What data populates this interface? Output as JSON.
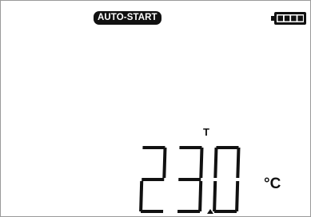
{
  "status_bar": {
    "mode_badge": "AUTO-START",
    "battery": {
      "icon": "battery-full-icon",
      "level": 1.0
    }
  },
  "measurement": {
    "label": "T",
    "value": "23.0",
    "unit": "°C"
  },
  "colors": {
    "background": "#ffffff",
    "segment": "#111111"
  }
}
